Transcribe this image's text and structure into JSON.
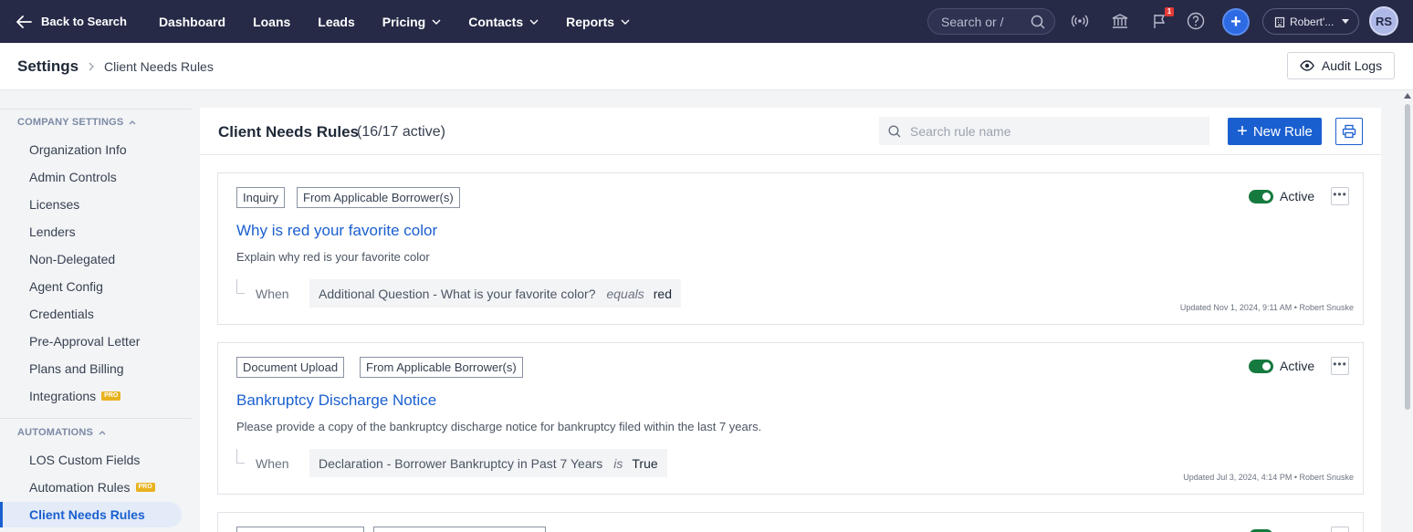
{
  "topnav": {
    "back_label": "Back to Search",
    "items": [
      {
        "label": "Dashboard",
        "has_dropdown": false
      },
      {
        "label": "Loans",
        "has_dropdown": false
      },
      {
        "label": "Leads",
        "has_dropdown": false
      },
      {
        "label": "Pricing",
        "has_dropdown": true
      },
      {
        "label": "Contacts",
        "has_dropdown": true
      },
      {
        "label": "Reports",
        "has_dropdown": true
      }
    ],
    "search_placeholder": "Search or /",
    "notification_count": "1",
    "org_label": "Robert'...",
    "avatar_initials": "RS"
  },
  "breadcrumb": {
    "root": "Settings",
    "current": "Client Needs Rules"
  },
  "audit_logs_label": "Audit Logs",
  "sidebar": {
    "sections": [
      {
        "title": "COMPANY SETTINGS",
        "items": [
          {
            "label": "Organization Info",
            "pro": false
          },
          {
            "label": "Admin Controls",
            "pro": false
          },
          {
            "label": "Licenses",
            "pro": false
          },
          {
            "label": "Lenders",
            "pro": false
          },
          {
            "label": "Non-Delegated",
            "pro": false
          },
          {
            "label": "Agent Config",
            "pro": false
          },
          {
            "label": "Credentials",
            "pro": false
          },
          {
            "label": "Pre-Approval Letter",
            "pro": false
          },
          {
            "label": "Plans and Billing",
            "pro": false
          },
          {
            "label": "Integrations",
            "pro": true
          }
        ]
      },
      {
        "title": "AUTOMATIONS",
        "items": [
          {
            "label": "LOS Custom Fields",
            "pro": false
          },
          {
            "label": "Automation Rules",
            "pro": true
          },
          {
            "label": "Client Needs Rules",
            "pro": false,
            "active": true
          }
        ]
      }
    ],
    "pro_badge": "PRO"
  },
  "main": {
    "title": "Client Needs Rules",
    "count": "(16/17 active)",
    "search_placeholder": "Search rule name",
    "new_rule_label": "New Rule"
  },
  "rules": [
    {
      "tags": [
        "Inquiry",
        "From Applicable Borrower(s)"
      ],
      "status": "Active",
      "title": "Why is red your favorite color",
      "description": "Explain why red is your favorite color",
      "when_label": "When",
      "condition": {
        "field": "Additional Question - What is your favorite color?",
        "operator": "equals",
        "value": "red"
      },
      "updated": "Updated Nov 1, 2024, 9:11 AM • Robert Snuske"
    },
    {
      "tags": [
        "Document Upload",
        "From Applicable Borrower(s)"
      ],
      "status": "Active",
      "title": "Bankruptcy Discharge Notice",
      "description": "Please provide a copy of the bankruptcy discharge notice for bankruptcy filed within the last 7 years.",
      "when_label": "When",
      "condition": {
        "field": "Declaration - Borrower Bankruptcy in Past 7 Years",
        "operator": "is",
        "value": "True"
      },
      "updated": "Updated Jul 3, 2024, 4:14 PM • Robert Snuske"
    }
  ],
  "colors": {
    "nav_bg": "#262a47",
    "accent": "#1a5fd0",
    "toggle_on": "#167a3f",
    "pro_badge": "#e8b21f"
  }
}
